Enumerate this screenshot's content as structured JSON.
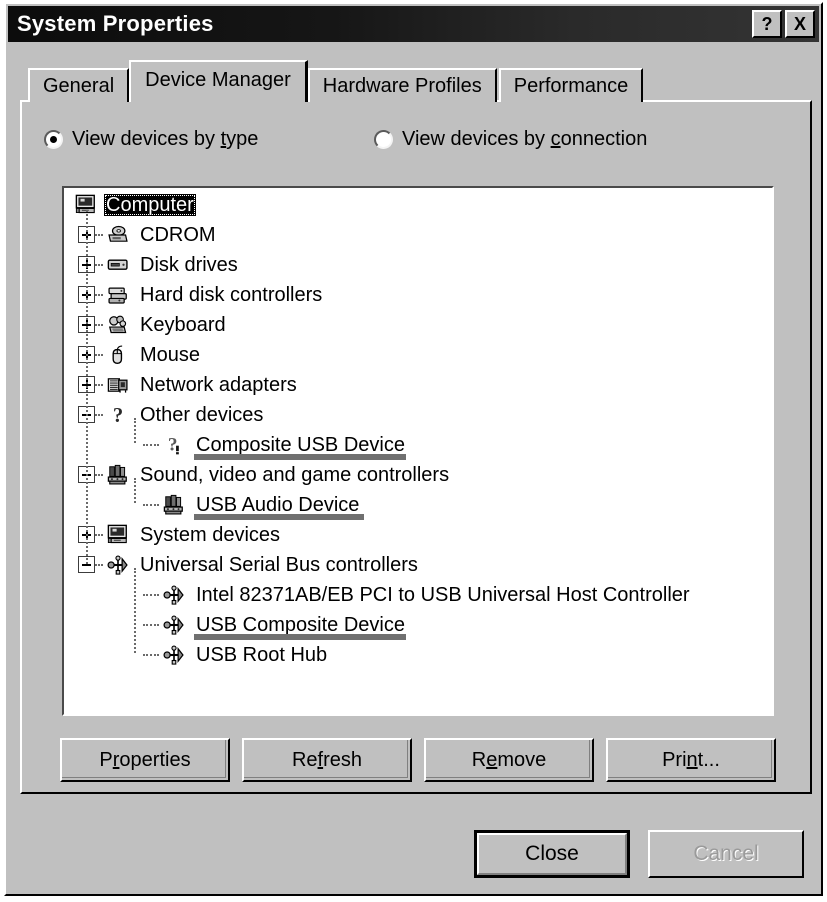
{
  "window": {
    "title": "System Properties",
    "help_button": "?",
    "close_button": "X"
  },
  "tabs": [
    {
      "label": "General",
      "active": false
    },
    {
      "label": "Device Manager",
      "active": true
    },
    {
      "label": "Hardware Profiles",
      "active": false
    },
    {
      "label": "Performance",
      "active": false
    }
  ],
  "view_options": [
    {
      "label_before": "View devices by ",
      "accel": "t",
      "label_after": "ype",
      "checked": true
    },
    {
      "label_before": "View devices by ",
      "accel": "c",
      "label_after": "onnection",
      "checked": false
    }
  ],
  "tree": [
    {
      "label": "Computer",
      "depth": 0,
      "icon": "computer-icon",
      "expander": "none",
      "selected": true,
      "annotated": false
    },
    {
      "label": "CDROM",
      "depth": 1,
      "icon": "cdrom-icon",
      "expander": "plus",
      "selected": false,
      "annotated": false
    },
    {
      "label": "Disk drives",
      "depth": 1,
      "icon": "diskdrive-icon",
      "expander": "plus",
      "selected": false,
      "annotated": false
    },
    {
      "label": "Hard disk controllers",
      "depth": 1,
      "icon": "hddcontroller-icon",
      "expander": "plus",
      "selected": false,
      "annotated": false
    },
    {
      "label": "Keyboard",
      "depth": 1,
      "icon": "keyboard-icon",
      "expander": "plus",
      "selected": false,
      "annotated": false
    },
    {
      "label": "Mouse",
      "depth": 1,
      "icon": "mouse-icon",
      "expander": "plus",
      "selected": false,
      "annotated": false
    },
    {
      "label": "Network adapters",
      "depth": 1,
      "icon": "network-icon",
      "expander": "plus",
      "selected": false,
      "annotated": false
    },
    {
      "label": "Other devices",
      "depth": 1,
      "icon": "question-icon",
      "expander": "minus",
      "selected": false,
      "annotated": false
    },
    {
      "label": "Composite USB Device",
      "depth": 2,
      "icon": "question-warn-icon",
      "expander": "none",
      "selected": false,
      "annotated": true
    },
    {
      "label": "Sound, video and game controllers",
      "depth": 1,
      "icon": "sound-icon",
      "expander": "minus",
      "selected": false,
      "annotated": false
    },
    {
      "label": "USB Audio Device",
      "depth": 2,
      "icon": "sound-icon",
      "expander": "none",
      "selected": false,
      "annotated": true
    },
    {
      "label": "System devices",
      "depth": 1,
      "icon": "computer-icon",
      "expander": "plus",
      "selected": false,
      "annotated": false
    },
    {
      "label": "Universal Serial Bus controllers",
      "depth": 1,
      "icon": "usb-icon",
      "expander": "minus",
      "selected": false,
      "annotated": false
    },
    {
      "label": "Intel 82371AB/EB PCI to USB Universal Host Controller",
      "depth": 2,
      "icon": "usb-icon",
      "expander": "none",
      "selected": false,
      "annotated": false
    },
    {
      "label": "USB Composite Device",
      "depth": 2,
      "icon": "usb-icon",
      "expander": "none",
      "selected": false,
      "annotated": true
    },
    {
      "label": "USB Root Hub",
      "depth": 2,
      "icon": "usb-icon",
      "expander": "none",
      "selected": false,
      "annotated": false
    }
  ],
  "action_buttons": [
    {
      "before": "P",
      "accel": "r",
      "after": "operties"
    },
    {
      "before": "Re",
      "accel": "f",
      "after": "resh"
    },
    {
      "before": "R",
      "accel": "e",
      "after": "move"
    },
    {
      "before": "Pri",
      "accel": "n",
      "after": "t..."
    }
  ],
  "dialog_buttons": {
    "close": "Close",
    "cancel": "Cancel",
    "cancel_disabled": true
  },
  "colors": {
    "face": "#c0c0c0",
    "titlebar_dark": "#0c0c0c",
    "annotation_underline": "#707070",
    "tree_background": "#ffffff",
    "selection_background": "#000000",
    "disabled_text": "#9a9a9a"
  }
}
